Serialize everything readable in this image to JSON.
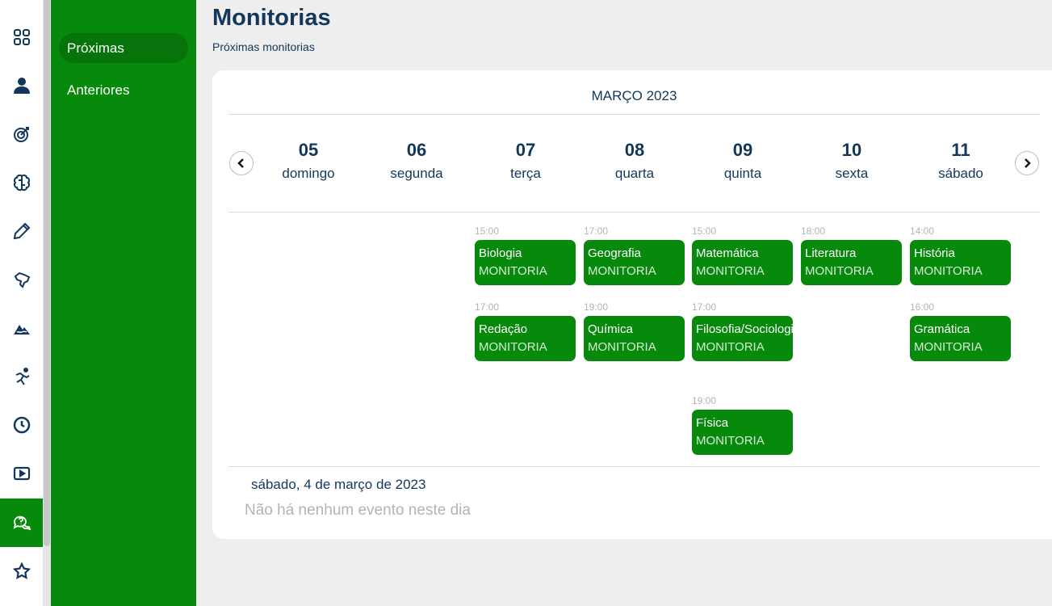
{
  "rail": {
    "items": [
      {
        "icon": "grid-icon"
      },
      {
        "icon": "user-icon"
      },
      {
        "icon": "target-icon"
      },
      {
        "icon": "brain-icon"
      },
      {
        "icon": "pencil-icon"
      },
      {
        "icon": "map-brazil-icon"
      },
      {
        "icon": "mountain-icon"
      },
      {
        "icon": "runner-icon"
      },
      {
        "icon": "clock-icon"
      },
      {
        "icon": "video-icon"
      },
      {
        "icon": "chat-question-icon",
        "active": true
      },
      {
        "icon": "star-icon"
      }
    ],
    "accent": "#078a0b"
  },
  "subnav": {
    "items": [
      {
        "label": "Próximas",
        "active": true
      },
      {
        "label": "Anteriores"
      }
    ]
  },
  "page": {
    "title": "Monitorias",
    "subtitle": "Próximas monitorias"
  },
  "calendar": {
    "month": "MARÇO 2023",
    "days": [
      {
        "num": "05",
        "dow": "domingo"
      },
      {
        "num": "06",
        "dow": "segunda"
      },
      {
        "num": "07",
        "dow": "terça"
      },
      {
        "num": "08",
        "dow": "quarta"
      },
      {
        "num": "09",
        "dow": "quinta"
      },
      {
        "num": "10",
        "dow": "sexta"
      },
      {
        "num": "11",
        "dow": "sábado"
      }
    ],
    "events": [
      {
        "day": 1,
        "time": "15:00",
        "title": "Biologia",
        "type": "MONITORIA"
      },
      {
        "day": 1,
        "time": "17:00",
        "title": "Redação",
        "type": "MONITORIA"
      },
      {
        "day": 2,
        "time": "17:00",
        "title": "Geografia",
        "type": "MONITORIA"
      },
      {
        "day": 2,
        "time": "19:00",
        "title": "Química",
        "type": "MONITORIA"
      },
      {
        "day": 3,
        "time": "15:00",
        "title": "Matemática",
        "type": "MONITORIA"
      },
      {
        "day": 3,
        "time": "17:00",
        "title": "Filosofia/Sociologia",
        "type": "MONITORIA"
      },
      {
        "day": 3,
        "time": "19:00",
        "title": "Física",
        "type": "MONITORIA"
      },
      {
        "day": 4,
        "time": "18:00",
        "title": "Literatura",
        "type": "MONITORIA"
      },
      {
        "day": 5,
        "time": "14:00",
        "title": "História",
        "type": "MONITORIA"
      },
      {
        "day": 5,
        "time": "16:00",
        "title": "Gramática",
        "type": "MONITORIA"
      }
    ],
    "selected_date": "sábado, 4 de março de 2023",
    "empty_message": "Não há nenhum evento neste dia",
    "prev_icon": "chevron-left-icon",
    "next_icon": "chevron-right-icon"
  }
}
